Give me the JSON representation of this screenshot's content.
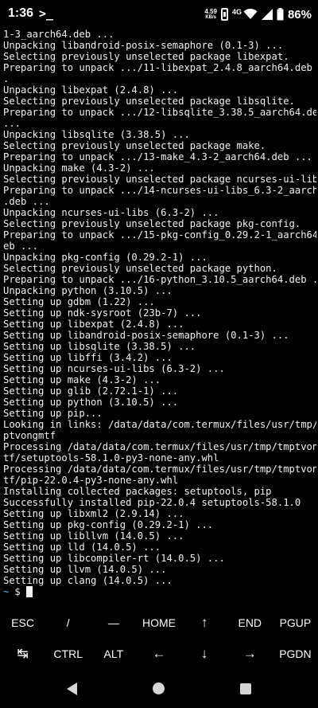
{
  "status_bar": {
    "time": "1:36",
    "app_indicator": ">_",
    "net_speed_value": "4.59",
    "net_speed_unit": "KB/s",
    "network_type": "4G",
    "battery": "86%"
  },
  "terminal": {
    "lines": [
      "1-3_aarch64.deb ...",
      "Unpacking libandroid-posix-semaphore (0.1-3) ...",
      "Selecting previously unselected package libexpat.",
      "Preparing to unpack .../11-libexpat_2.4.8_aarch64.deb ..",
      ".",
      "Unpacking libexpat (2.4.8) ...",
      "Selecting previously unselected package libsqlite.",
      "Preparing to unpack .../12-libsqlite_3.38.5_aarch64.deb",
      "...",
      "Unpacking libsqlite (3.38.5) ...",
      "Selecting previously unselected package make.",
      "Preparing to unpack .../13-make_4.3-2_aarch64.deb ...",
      "Unpacking make (4.3-2) ...",
      "Selecting previously unselected package ncurses-ui-libs.",
      "Preparing to unpack .../14-ncurses-ui-libs_6.3-2_aarch64",
      ".deb ...",
      "Unpacking ncurses-ui-libs (6.3-2) ...",
      "Selecting previously unselected package pkg-config.",
      "Preparing to unpack .../15-pkg-config_0.29.2-1_aarch64.d",
      "eb ...",
      "Unpacking pkg-config (0.29.2-1) ...",
      "Selecting previously unselected package python.",
      "Preparing to unpack .../16-python_3.10.5_aarch64.deb ...",
      "Unpacking python (3.10.5) ...",
      "Setting up gdbm (1.22) ...",
      "Setting up ndk-sysroot (23b-7) ...",
      "Setting up libexpat (2.4.8) ...",
      "Setting up libandroid-posix-semaphore (0.1-3) ...",
      "Setting up libsqlite (3.38.5) ...",
      "Setting up libffi (3.4.2) ...",
      "Setting up ncurses-ui-libs (6.3-2) ...",
      "Setting up make (4.3-2) ...",
      "Setting up glib (2.72.1-1) ...",
      "Setting up python (3.10.5) ...",
      "Setting up pip...",
      "Looking in links: /data/data/com.termux/files/usr/tmp/tm",
      "ptvongmtf",
      "Processing /data/data/com.termux/files/usr/tmp/tmptvongm",
      "tf/setuptools-58.1.0-py3-none-any.whl",
      "Processing /data/data/com.termux/files/usr/tmp/tmptvongm",
      "tf/pip-22.0.4-py3-none-any.whl",
      "Installing collected packages: setuptools, pip",
      "Successfully installed pip-22.0.4 setuptools-58.1.0",
      "Setting up libxml2 (2.9.14) ...",
      "Setting up pkg-config (0.29.2-1) ...",
      "Setting up libllvm (14.0.5) ...",
      "Setting up lld (14.0.5) ...",
      "Setting up libcompiler-rt (14.0.5) ...",
      "Setting up llvm (14.0.5) ...",
      "Setting up clang (14.0.5) ..."
    ],
    "prompt_path": "~",
    "prompt_symbol": "$"
  },
  "extra_keys": {
    "row1": [
      "ESC",
      "/",
      "—",
      "HOME",
      "↑",
      "END",
      "PGUP"
    ],
    "row2": [
      "↹",
      "CTRL",
      "ALT",
      "←",
      "↓",
      "→",
      "PGDN"
    ]
  }
}
